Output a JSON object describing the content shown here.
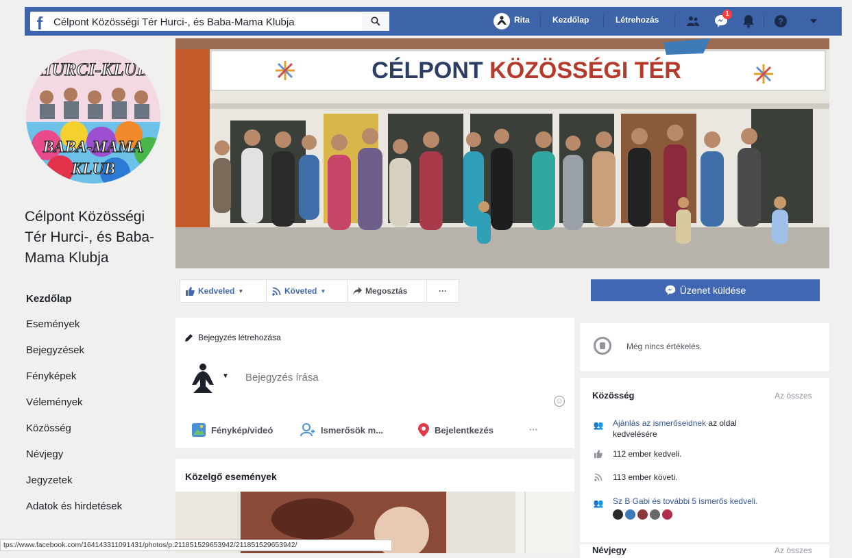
{
  "colors": {
    "brand": "#3d63a8",
    "button_blue": "#4267b2",
    "link": "#365899",
    "badge": "#fa3e3e"
  },
  "topbar": {
    "search_value": "Célpont Közösségi Tér Hurci-, és Baba-Mama Klubja",
    "user_name": "Rita",
    "home_label": "Kezdőlap",
    "create_label": "Létrehozás",
    "messenger_badge": "1",
    "icons": [
      "facebook-logo-icon",
      "search-icon",
      "user-avatar-icon",
      "friends-icon",
      "messenger-icon",
      "bell-icon",
      "help-icon",
      "dropdown-icon"
    ]
  },
  "avatar": {
    "top_text": "HURCI-KLUB",
    "bottom_text_1": "BABA-MAMA",
    "bottom_text_2": "KLUB"
  },
  "page": {
    "name": "Célpont Közösségi Tér Hurci-, és Baba-Mama Klubja"
  },
  "sidebar": {
    "items": [
      {
        "label": "Kezdőlap",
        "active": true
      },
      {
        "label": "Események"
      },
      {
        "label": "Bejegyzések"
      },
      {
        "label": "Fényképek"
      },
      {
        "label": "Vélemények"
      },
      {
        "label": "Közösség"
      },
      {
        "label": "Névjegy"
      },
      {
        "label": "Jegyzetek"
      },
      {
        "label": "Adatok és hirdetések"
      }
    ]
  },
  "cover": {
    "banner_part1": "CÉLPONT ",
    "banner_part2": "KÖZÖSSÉGI TÉR"
  },
  "actions": {
    "like": "Kedveled",
    "follow": "Követed",
    "share": "Megosztás",
    "more": "···"
  },
  "message_button": "Üzenet küldése",
  "composer": {
    "create_label": "Bejegyzés létrehozása",
    "placeholder": "Bejegyzés írása",
    "photo": "Fénykép/videó",
    "friends": "Ismerősök m...",
    "checkin": "Bejelentkezés",
    "more": "···"
  },
  "events": {
    "title": "Közelgő események"
  },
  "rating": {
    "text": "Még nincs értékelés."
  },
  "community": {
    "title": "Közösség",
    "see_all": "Az összes",
    "invite_link": "Ajánlás az ismerőseidnek",
    "invite_rest": " az oldal",
    "invite_rest2": "kedvelésére",
    "likes": "112 ember kedveli.",
    "follows": "113 ember követi.",
    "friends_like": "Sz B Gabi és további 5 ismerős kedveli."
  },
  "about": {
    "title": "Névjegy",
    "see_all": "Az összes"
  },
  "status_url": "tps://www.facebook.com/164143311091431/photos/p.211851529653942/211851529653942/"
}
